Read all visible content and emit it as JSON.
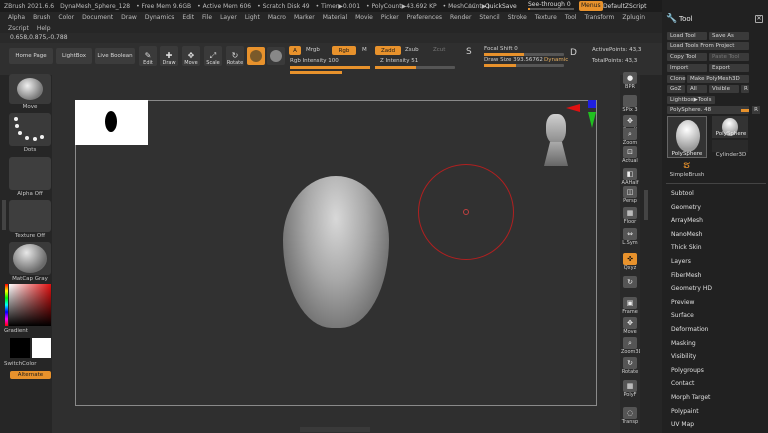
{
  "titlebar": {
    "app": "ZBrush 2021.6.6",
    "doc": "DynaMesh_Sphere_128",
    "items": [
      "• Free Mem 9.6GB",
      "• Active Mem 606",
      "• Scratch Disk 49",
      "• Timer▶0.001",
      "• PolyCount▶43.692 KP",
      "• MeshCount▶1"
    ],
    "ac": "AC",
    "quicksave": "QuickSave",
    "seethrough": "See-through  0",
    "menus": "Menus",
    "script": "DefaultZScript"
  },
  "menubar": [
    "Alpha",
    "Brush",
    "Color",
    "Document",
    "Draw",
    "Dynamics",
    "Edit",
    "File",
    "Layer",
    "Light",
    "Macro",
    "Marker",
    "Material",
    "Movie",
    "Picker",
    "Preferences",
    "Render",
    "Stencil",
    "Stroke",
    "Texture",
    "Tool",
    "Transform",
    "Zplugin"
  ],
  "menubar2": [
    "Zscript",
    "Help"
  ],
  "coords": "0.658,0.875,-0.788",
  "shelf": {
    "homepage": "Home Page",
    "lightbox": "LightBox",
    "liveboolean": "Live Boolean",
    "edit": "Edit",
    "draw": "Draw",
    "move": "Move",
    "scale": "Scale",
    "rotate": "Rotate",
    "a": "A",
    "mrgb": "Mrgb",
    "rgb": "Rgb",
    "m": "M",
    "zadd": "Zadd",
    "zsub": "Zsub",
    "zcut": "Zcut",
    "rgb_intensity": "Rgb Intensity 100",
    "z_intensity": "Z Intensity 51",
    "focal_shift": "Focal Shift 0",
    "draw_size": "Draw Size 393.56762",
    "dynamic": "Dynamic",
    "active_points": "ActivePoints: 43,3",
    "total_points": "TotalPoints: 43,3",
    "rgb_intensity_value": 1.0,
    "z_intensity_value": 0.51,
    "focal_shift_value": 0.5,
    "draw_size_value": 0.4
  },
  "left": {
    "move": "Move",
    "dots": "Dots",
    "alpha_off": "Alpha Off",
    "texture_off": "Texture Off",
    "matcap": "MatCap Gray",
    "gradient": "Gradient",
    "switchcolor": "SwitchColor",
    "alternate": "Alternate"
  },
  "rightshelf": [
    {
      "label": "BPR",
      "g": "●"
    },
    {
      "label": "SPix 3",
      "g": ""
    },
    {
      "label": "Scroll",
      "g": "✥"
    },
    {
      "label": "Zoom",
      "g": "⌕"
    },
    {
      "label": "Actual",
      "g": "⊡"
    },
    {
      "label": "AAHalf",
      "g": "◧"
    },
    {
      "label": "Persp",
      "g": "◫"
    },
    {
      "label": "Floor",
      "g": "▦"
    },
    {
      "label": "L.Sym",
      "g": "⇔"
    },
    {
      "label": "Qxyz",
      "g": "✜"
    },
    {
      "label": "",
      "g": "↻"
    },
    {
      "label": "Frame",
      "g": "▣"
    },
    {
      "label": "Move",
      "g": "✥"
    },
    {
      "label": "Zoom3D",
      "g": "⌕"
    },
    {
      "label": "Rotate",
      "g": "↻"
    },
    {
      "label": "PolyF",
      "g": "▦"
    },
    {
      "label": "Transp",
      "g": "◌"
    }
  ],
  "tool": {
    "title": "Tool",
    "load_tool": "Load Tool",
    "save_as": "Save As",
    "load_from_project": "Load Tools From Project",
    "copy_tool": "Copy Tool",
    "paste_tool": "Paste Tool",
    "import": "Import",
    "export": "Export",
    "clone": "Clone",
    "make_polymesh": "Make PolyMesh3D",
    "goz": "GoZ",
    "all": "All",
    "visible": "Visible",
    "r": "R",
    "lightbox_tools": "Lightbox▶Tools",
    "polysphere_slider": "PolySphere. 48",
    "thumbs": [
      "PolySphere",
      "PolySphere",
      "Cylinder3D",
      "SimpleBrush"
    ],
    "subpalettes": [
      "Subtool",
      "Geometry",
      "ArrayMesh",
      "NanoMesh",
      "Thick Skin",
      "Layers",
      "FiberMesh",
      "Geometry HD",
      "Preview",
      "Surface",
      "Deformation",
      "Masking",
      "Visibility",
      "Polygroups",
      "Contact",
      "Morph Target",
      "Polypaint",
      "UV Map"
    ]
  }
}
